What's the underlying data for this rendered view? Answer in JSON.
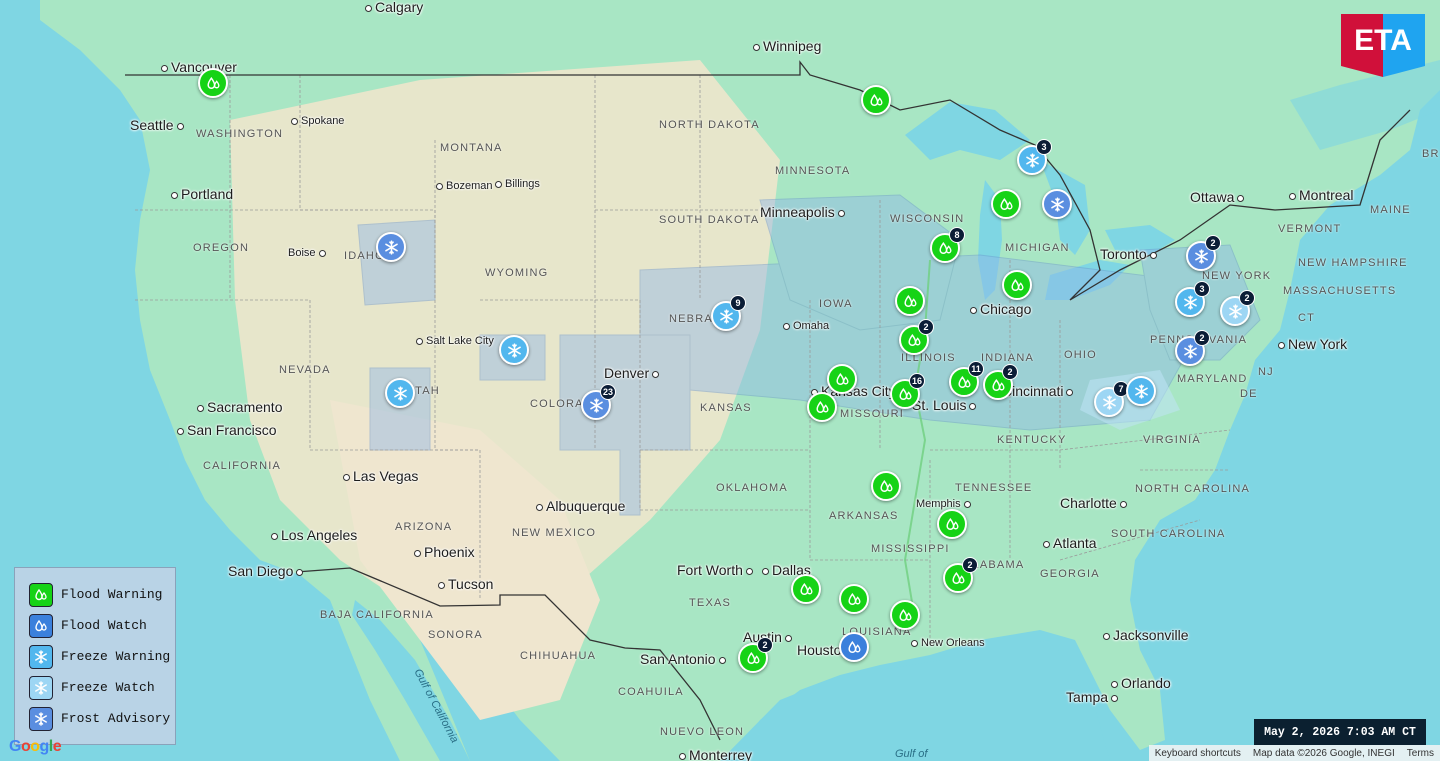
{
  "logo": {
    "text": "ETA"
  },
  "timestamp": "May 2, 2026 7:03 AM CT",
  "footer": {
    "keyboard": "Keyboard shortcuts",
    "mapdata": "Map data ©2026 Google, INEGI",
    "terms": "Terms"
  },
  "google": "Google",
  "legend": [
    {
      "label": "Flood Warning",
      "type": "flood-warning",
      "color": "#16d316",
      "icon": "water-drops-icon"
    },
    {
      "label": "Flood Watch",
      "type": "flood-watch",
      "color": "#3b80dc",
      "icon": "water-drops-icon"
    },
    {
      "label": "Freeze Warning",
      "type": "freeze-warning",
      "color": "#52b7ee",
      "icon": "snowflake-icon"
    },
    {
      "label": "Freeze Watch",
      "type": "freeze-watch",
      "color": "#9dd6f4",
      "icon": "snowflake-icon"
    },
    {
      "label": "Frost Advisory",
      "type": "frost-advisory",
      "color": "#5a8ee0",
      "icon": "snowflake-icon"
    }
  ],
  "cities": [
    "Calgary",
    "Vancouver",
    "Seattle",
    "Spokane",
    "Portland",
    "Boise",
    "Bozeman",
    "Billings",
    "Winnipeg",
    "Minneapolis",
    "Salt Lake City",
    "Denver",
    "Omaha",
    "Kansas City",
    "St. Louis",
    "Chicago",
    "Toronto",
    "Ottawa",
    "Montreal",
    "New York",
    "Sacramento",
    "San Francisco",
    "Las Vegas",
    "Los Angeles",
    "San Diego",
    "Phoenix",
    "Tucson",
    "Albuquerque",
    "Fort Worth",
    "Dallas",
    "Austin",
    "San Antonio",
    "Houston",
    "New Orleans",
    "Memphis",
    "Atlanta",
    "Charlotte",
    "Jacksonville",
    "Tampa",
    "Orlando",
    "Monterrey",
    "Cincinnati"
  ],
  "regions": [
    "WASHINGTON",
    "OREGON",
    "IDAHO",
    "MONTANA",
    "WYOMING",
    "NEVADA",
    "UTAH",
    "COLORADO",
    "CALIFORNIA",
    "ARIZONA",
    "NEW MEXICO",
    "NORTH DAKOTA",
    "SOUTH DAKOTA",
    "NEBRASKA",
    "KANSAS",
    "OKLAHOMA",
    "TEXAS",
    "MINNESOTA",
    "IOWA",
    "MISSOURI",
    "ARKANSAS",
    "LOUISIANA",
    "WISCONSIN",
    "ILLINOIS",
    "MICHIGAN",
    "INDIANA",
    "OHIO",
    "KENTUCKY",
    "TENNESSEE",
    "MISSISSIPPI",
    "ALABAMA",
    "GEORGIA",
    "NORTH CAROLINA",
    "SOUTH CAROLINA",
    "VIRGINIA",
    "PENNSYLVANIA",
    "NEW YORK",
    "MARYLAND",
    "VERMONT",
    "NEW HAMPSHIRE",
    "MASSACHUSETTS",
    "MAINE",
    "CT",
    "NJ",
    "DE",
    "BAJA CALIFORNIA",
    "SONORA",
    "CHIHUAHUA",
    "COAHUILA",
    "NUEVO LEON",
    "BR"
  ],
  "water": [
    "Gulf of California",
    "Gulf of"
  ],
  "markers": [
    {
      "type": "flood-warning",
      "count": ""
    },
    {
      "type": "flood-warning",
      "count": ""
    },
    {
      "type": "freeze-warning",
      "count": "3"
    },
    {
      "type": "flood-warning",
      "count": ""
    },
    {
      "type": "frost-advisory",
      "count": ""
    },
    {
      "type": "flood-warning",
      "count": "8"
    },
    {
      "type": "frost-advisory",
      "count": ""
    },
    {
      "type": "frost-advisory",
      "count": "2"
    },
    {
      "type": "flood-warning",
      "count": ""
    },
    {
      "type": "flood-warning",
      "count": ""
    },
    {
      "type": "freeze-warning",
      "count": "9"
    },
    {
      "type": "freeze-warning",
      "count": "3"
    },
    {
      "type": "freeze-watch",
      "count": "2"
    },
    {
      "type": "freeze-warning",
      "count": ""
    },
    {
      "type": "flood-warning",
      "count": "2"
    },
    {
      "type": "frost-advisory",
      "count": "2"
    },
    {
      "type": "freeze-warning",
      "count": ""
    },
    {
      "type": "flood-warning",
      "count": ""
    },
    {
      "type": "frost-advisory",
      "count": "23"
    },
    {
      "type": "flood-warning",
      "count": "11"
    },
    {
      "type": "flood-warning",
      "count": "2"
    },
    {
      "type": "flood-warning",
      "count": "16"
    },
    {
      "type": "flood-warning",
      "count": ""
    },
    {
      "type": "freeze-watch",
      "count": "7"
    },
    {
      "type": "freeze-warning",
      "count": ""
    },
    {
      "type": "flood-warning",
      "count": ""
    },
    {
      "type": "flood-warning",
      "count": ""
    },
    {
      "type": "flood-warning",
      "count": "2"
    },
    {
      "type": "flood-warning",
      "count": ""
    },
    {
      "type": "flood-warning",
      "count": ""
    },
    {
      "type": "flood-warning",
      "count": ""
    },
    {
      "type": "flood-warning",
      "count": "2"
    },
    {
      "type": "flood-watch",
      "count": ""
    }
  ]
}
